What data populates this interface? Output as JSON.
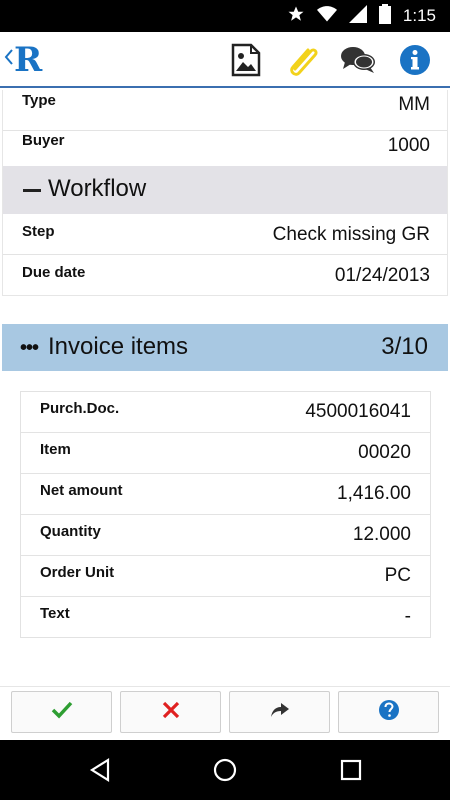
{
  "status_bar": {
    "time": "1:15"
  },
  "header": {
    "logo": "R",
    "icons": [
      "image-icon",
      "paperclip-icon",
      "chat-icon",
      "info-icon"
    ]
  },
  "details": {
    "rows": [
      {
        "label": "Type",
        "value": "MM"
      },
      {
        "label": "Buyer",
        "value": "1000"
      }
    ]
  },
  "workflow": {
    "title": "Workflow",
    "rows": [
      {
        "label": "Step",
        "value": "Check missing GR"
      },
      {
        "label": "Due date",
        "value": "01/24/2013"
      }
    ]
  },
  "invoice_items": {
    "title": "Invoice items",
    "count": "3/10",
    "rows": [
      {
        "label": "Purch.Doc.",
        "value": "4500016041"
      },
      {
        "label": "Item",
        "value": "00020"
      },
      {
        "label": "Net amount",
        "value": "1,416.00"
      },
      {
        "label": "Quantity",
        "value": "12.000"
      },
      {
        "label": "Order Unit",
        "value": "PC"
      },
      {
        "label": "Text",
        "value": "-"
      }
    ]
  },
  "actions": [
    "approve-check-icon",
    "reject-x-icon",
    "forward-icon",
    "help-icon"
  ],
  "colors": {
    "accent": "#1a73c4",
    "section_bg": "#e3e2e7",
    "items_bg": "#a8c8e2",
    "approve": "#2e9e32",
    "reject": "#e02020",
    "clip": "#f2d21b"
  }
}
